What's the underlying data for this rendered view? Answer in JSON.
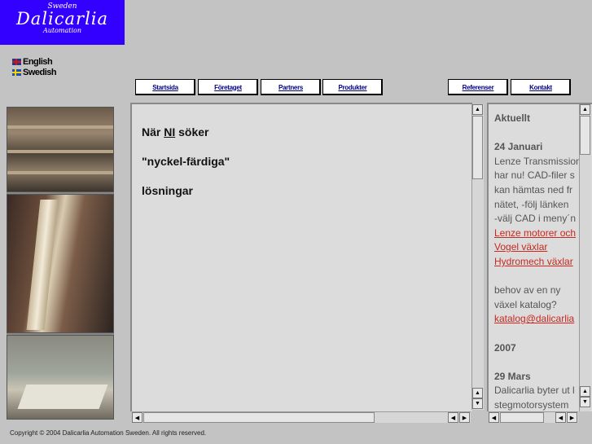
{
  "logo": {
    "country": "Sweden",
    "name": "Dalicarlia",
    "tagline": "Automation"
  },
  "languages": [
    {
      "label": "English",
      "flag": "uk-flag-icon"
    },
    {
      "label": "Swedish",
      "flag": "sweden-flag-icon"
    }
  ],
  "nav": [
    {
      "label": "Startsida"
    },
    {
      "label": "Företaget"
    },
    {
      "label": "Partners"
    },
    {
      "label": "Produkter"
    },
    {
      "label": "Referenser"
    },
    {
      "label": "Kontakt"
    }
  ],
  "main": {
    "line1_prefix": "När ",
    "line1_em": "NI",
    "line1_suffix": " söker",
    "line2": "\"nyckel-färdiga\"",
    "line3": "lösningar"
  },
  "news": {
    "title": "Aktuellt",
    "date1": "24 Januari",
    "text1": [
      "Lenze Transmission",
      "har nu! CAD-filer s",
      "kan hämtas ned fr",
      "nätet, -följ länken",
      "-välj CAD i meny´n"
    ],
    "links1": [
      "Lenze motorer och",
      "Vogel växlar",
      "Hydromech växlar"
    ],
    "text2": [
      "behov av en ny",
      "växel katalog?"
    ],
    "email": "katalog@dalicarlia",
    "year": "2007",
    "date2": "29 Mars",
    "text3": [
      "Dalicarlia byter ut l",
      "stegmotorsystem"
    ]
  },
  "footer": {
    "text": "Copyright © 2004 Dalicarlia Automation Sweden. All rights reserved."
  },
  "colors": {
    "logo_bg": "#3300ff",
    "nav_text": "#000080",
    "link": "#c8281e",
    "page_bg": "#c3c3c3"
  }
}
